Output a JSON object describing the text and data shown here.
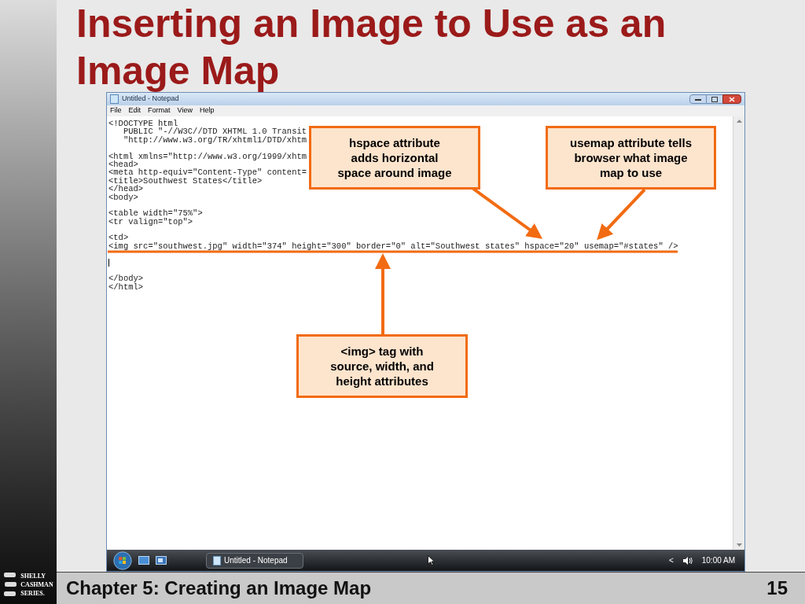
{
  "slide": {
    "title": "Inserting an Image to Use as an Image Map",
    "footer": "Chapter 5: Creating an Image Map",
    "page_number": "15",
    "logo": [
      "SHELLY",
      "CASHMAN",
      "SERIES."
    ]
  },
  "window": {
    "title": "Untitled - Notepad",
    "menu": [
      "File",
      "Edit",
      "Format",
      "View",
      "Help"
    ],
    "blocks": [
      {
        "kind": "code",
        "lines": [
          "<!DOCTYPE html",
          "   PUBLIC \"-//W3C//DTD XHTML 1.0 Transit",
          "   \"http://www.w3.org/TR/xhtml1/DTD/xhtm"
        ]
      },
      {
        "kind": "code",
        "lines": [
          "<html xmlns=\"http://www.w3.org/1999/xhtm",
          "<head>",
          "<meta http-equiv=\"Content-Type\" content=",
          "<title>Southwest States</title>",
          "</head>",
          "<body>"
        ]
      },
      {
        "kind": "code",
        "lines": [
          "<table width=\"75%\">",
          "<tr valign=\"top\">"
        ]
      },
      {
        "kind": "code",
        "lines": [
          "<td>",
          "<img src=\"southwest.jpg\" width=\"374\" height=\"300\" border=\"0\" alt=\"Southwest states\" hspace=\"20\" usemap=\"#states\" />"
        ]
      },
      {
        "kind": "caret"
      },
      {
        "kind": "code",
        "lines": [
          "</body>",
          "</html>"
        ]
      }
    ],
    "taskbar": {
      "task": "Untitled - Notepad",
      "tray_chevron": "<",
      "clock": "10:00 AM"
    }
  },
  "callouts": [
    {
      "text": "hspace attribute adds horizontal space around image"
    },
    {
      "text": "usemap attribute tells browser what image map to use"
    },
    {
      "text": "<img> tag with source, width, and height attributes"
    }
  ]
}
